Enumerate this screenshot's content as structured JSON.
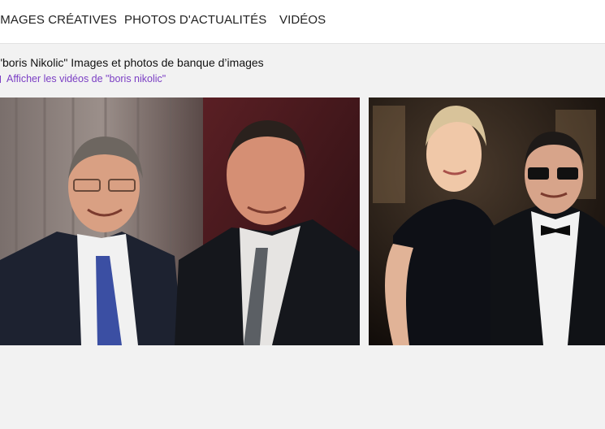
{
  "tabs": [
    {
      "label": "IMAGES CRÉATIVES"
    },
    {
      "label": "PHOTOS D'ACTUALITÉS"
    },
    {
      "label": "VIDÉOS"
    }
  ],
  "results": {
    "heading": "\"boris Nikolic\" Images et photos de banque d’images",
    "video_link": "Afficher les vidéos de \"boris nikolic\""
  },
  "colors": {
    "link": "#7b3fc4",
    "page_bg": "#f2f2f2",
    "nav_bg": "#ffffff"
  }
}
